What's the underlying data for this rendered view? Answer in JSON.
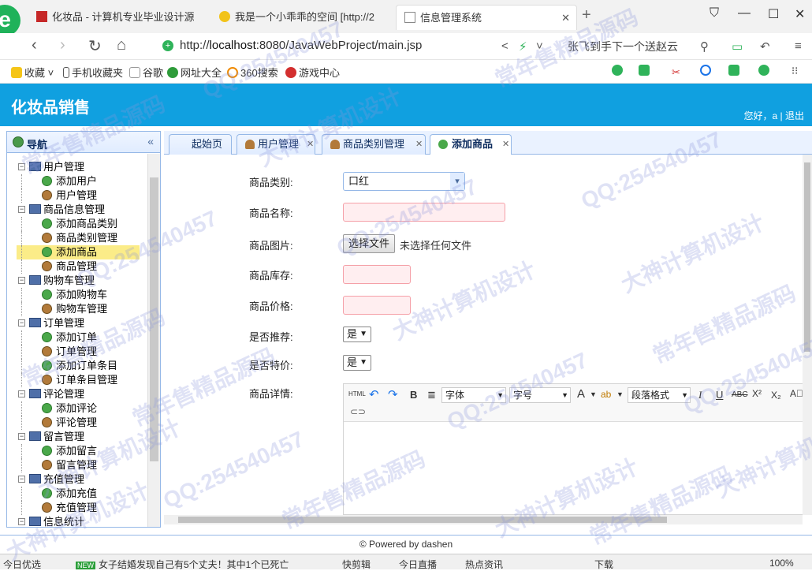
{
  "browser": {
    "tabs": [
      {
        "title": "化妆品 - 计算机专业毕业设计源",
        "active": false
      },
      {
        "title": "我是一个小乖乖的空间 [http://2",
        "active": false
      },
      {
        "title": "信息管理系统",
        "active": true
      }
    ],
    "url_prefix": "http://",
    "url_host": "localhost",
    "url_rest": ":8080/JavaWebProject/main.jsp",
    "news_text": "张飞到手下一个送赵云",
    "bookmarks": [
      "收藏",
      "手机收藏夹",
      "谷歌",
      "网址大全",
      "360搜索",
      "游戏中心"
    ]
  },
  "app": {
    "title": "化妆品销售",
    "greeting": "您好，a",
    "separator": "|",
    "logout": "退出"
  },
  "nav": {
    "title": "导航",
    "collapse_icon": "«",
    "groups": [
      {
        "label": "用户管理",
        "children": [
          {
            "label": "添加用户",
            "icon": "add-icon"
          },
          {
            "label": "用户管理",
            "icon": "user-icon"
          }
        ]
      },
      {
        "label": "商品信息管理",
        "children": [
          {
            "label": "添加商品类别",
            "icon": "add-icon"
          },
          {
            "label": "商品类别管理",
            "icon": "user-icon"
          },
          {
            "label": "添加商品",
            "icon": "add-icon",
            "selected": true
          },
          {
            "label": "商品管理",
            "icon": "user-icon"
          }
        ]
      },
      {
        "label": "购物车管理",
        "children": [
          {
            "label": "添加购物车",
            "icon": "add-icon"
          },
          {
            "label": "购物车管理",
            "icon": "user-icon"
          }
        ]
      },
      {
        "label": "订单管理",
        "children": [
          {
            "label": "添加订单",
            "icon": "add-icon"
          },
          {
            "label": "订单管理",
            "icon": "user-icon"
          },
          {
            "label": "添加订单条目",
            "icon": "add-icon"
          },
          {
            "label": "订单条目管理",
            "icon": "user-icon"
          }
        ]
      },
      {
        "label": "评论管理",
        "children": [
          {
            "label": "添加评论",
            "icon": "add-icon"
          },
          {
            "label": "评论管理",
            "icon": "user-icon"
          }
        ]
      },
      {
        "label": "留言管理",
        "children": [
          {
            "label": "添加留言",
            "icon": "add-icon"
          },
          {
            "label": "留言管理",
            "icon": "user-icon"
          }
        ]
      },
      {
        "label": "充值管理",
        "children": [
          {
            "label": "添加充值",
            "icon": "add-icon"
          },
          {
            "label": "充值管理",
            "icon": "user-icon"
          }
        ]
      },
      {
        "label": "信息统计",
        "children": []
      }
    ]
  },
  "tabs": [
    {
      "label": "起始页",
      "closable": false,
      "active": false
    },
    {
      "label": "用户管理",
      "closable": true,
      "active": false
    },
    {
      "label": "商品类别管理",
      "closable": true,
      "active": false
    },
    {
      "label": "添加商品",
      "closable": true,
      "active": true
    }
  ],
  "form": {
    "category_label": "商品类别:",
    "category_value": "口红",
    "name_label": "商品名称:",
    "name_value": "",
    "image_label": "商品图片:",
    "file_button": "选择文件",
    "file_status": "未选择任何文件",
    "stock_label": "商品库存:",
    "stock_value": "",
    "price_label": "商品价格:",
    "price_value": "",
    "recommend_label": "是否推荐:",
    "recommend_value": "是",
    "special_label": "是否特价:",
    "special_value": "是",
    "detail_label": "商品详情:"
  },
  "editor": {
    "html_btn": "HTML",
    "bold": "B",
    "font_family": "字体",
    "font_size": "字号",
    "font_color": "A",
    "paragraph": "段落格式",
    "italic": "I",
    "underline": "U",
    "strike": "ABC",
    "superscript": "X²",
    "subscript": "X₂"
  },
  "footer": "© Powered by dashen",
  "statusbar": {
    "left": "今日优选",
    "badge": "NEW",
    "news": "女子结婚发现自己有5个丈夫！其中1个已死亡",
    "items": [
      "快剪辑",
      "今日直播",
      "热点资讯",
      "下载"
    ],
    "zoom": "100%"
  },
  "watermarks": [
    "QQ:254540457",
    "大神计算机设计",
    "常年售精品源码"
  ],
  "colors": {
    "header": "#10a0e0",
    "panel_border": "#95b8e7",
    "selected": "#fbec88",
    "invalid_field": "#ffeef0"
  }
}
